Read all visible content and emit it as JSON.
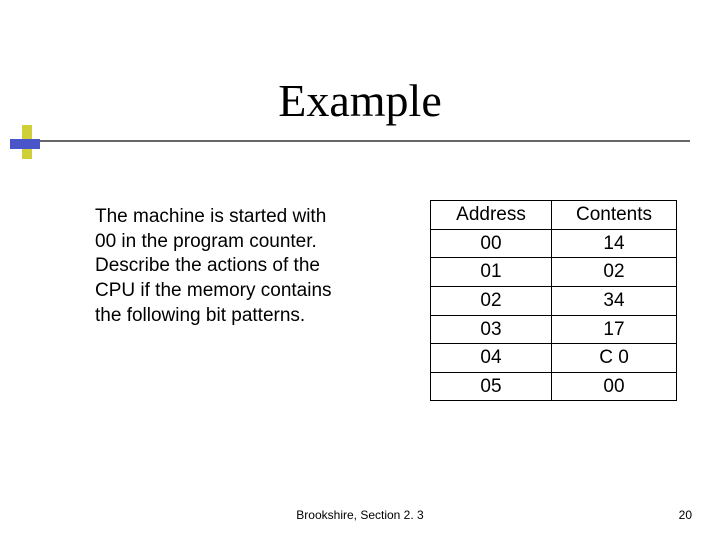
{
  "title": "Example",
  "body_text": "The machine is started with 00 in the program counter. Describe the actions of the CPU if the memory contains the following bit patterns.",
  "table": {
    "headers": [
      "Address",
      "Contents"
    ],
    "rows": [
      [
        "00",
        "14"
      ],
      [
        "01",
        "02"
      ],
      [
        "02",
        "34"
      ],
      [
        "03",
        "17"
      ],
      [
        "04",
        "C 0"
      ],
      [
        "05",
        "00"
      ]
    ]
  },
  "footer": {
    "center": "Brookshire, Section 2. 3",
    "page": "20"
  }
}
